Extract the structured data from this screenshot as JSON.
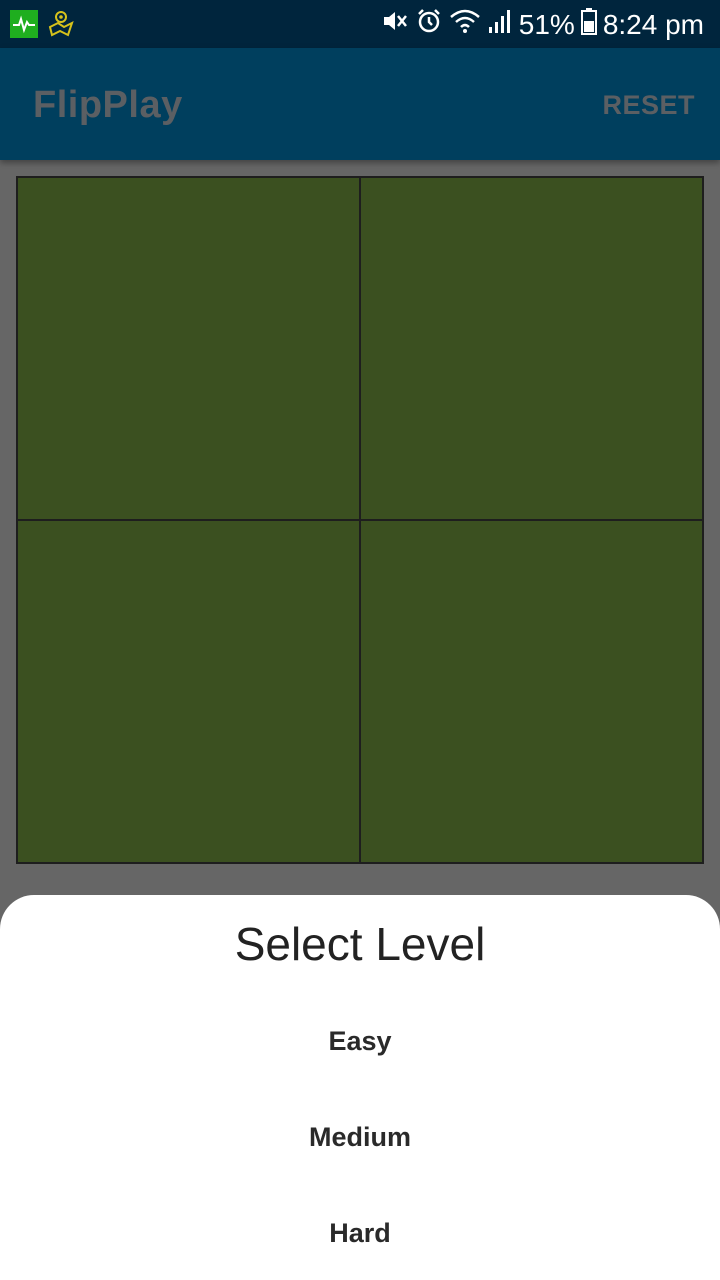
{
  "status_bar": {
    "battery": "51%",
    "time": "8:24 pm",
    "icons": [
      "health-monitor-icon",
      "maps-icon",
      "mute-icon",
      "alarm-icon",
      "wifi-icon",
      "signal-icon",
      "battery-icon"
    ]
  },
  "app_bar": {
    "title": "FlipPlay",
    "reset_label": "RESET"
  },
  "board": {
    "tile_color": "#3b5020",
    "tiles": [
      {
        "state": "face-down"
      },
      {
        "state": "face-down"
      },
      {
        "state": "face-down"
      },
      {
        "state": "face-down"
      }
    ]
  },
  "level_sheet": {
    "title": "Select Level",
    "options": [
      {
        "label": "Easy"
      },
      {
        "label": "Medium"
      },
      {
        "label": "Hard"
      }
    ]
  },
  "colors": {
    "status_bar": "#00253d",
    "app_bar": "#003f5e",
    "scrim": "#666666",
    "tile": "#3b5020"
  }
}
